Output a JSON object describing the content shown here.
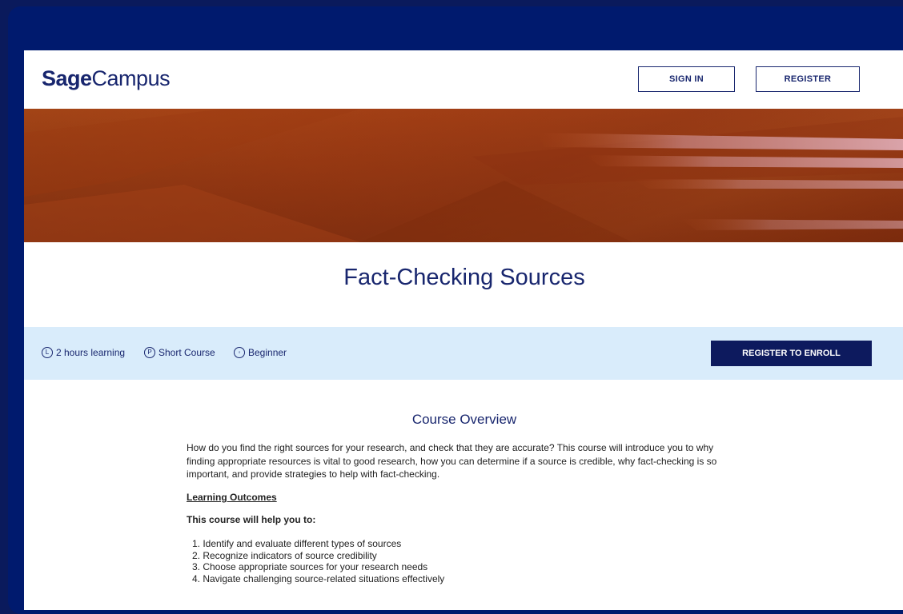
{
  "header": {
    "logo_sage": "Sage",
    "logo_campus": "Campus",
    "signin_label": "SIGN IN",
    "register_label": "REGISTER"
  },
  "course": {
    "title": "Fact-Checking Sources"
  },
  "meta": {
    "items": [
      {
        "icon": "clock-icon",
        "glyph": "L",
        "label": "2 hours learning"
      },
      {
        "icon": "course-type-icon",
        "glyph": "P",
        "label": "Short Course"
      },
      {
        "icon": "level-icon",
        "glyph": "◦",
        "label": "Beginner"
      }
    ],
    "enroll_label": "REGISTER TO ENROLL"
  },
  "overview": {
    "heading": "Course Overview",
    "body": "How do you find the right sources for your research, and check that they are accurate? This course will introduce you to why finding appropriate resources is vital to good research, how you can determine if a source is credible, why fact-checking is so important, and provide strategies to help with fact-checking.",
    "outcomes_heading": "Learning Outcomes",
    "help_text": "This course will help you to:",
    "outcomes": [
      "1. Identify and evaluate different types of sources",
      "2. Recognize indicators of source credibility",
      "3. Choose appropriate sources for your research needs",
      "4. Navigate challenging source-related situations effectively"
    ]
  },
  "colors": {
    "frame": "#001a6e",
    "brand_navy": "#18266e",
    "meta_band": "#d9ecfb",
    "enroll_button": "#0d1a5e",
    "hero_orange": "#b4481a"
  }
}
